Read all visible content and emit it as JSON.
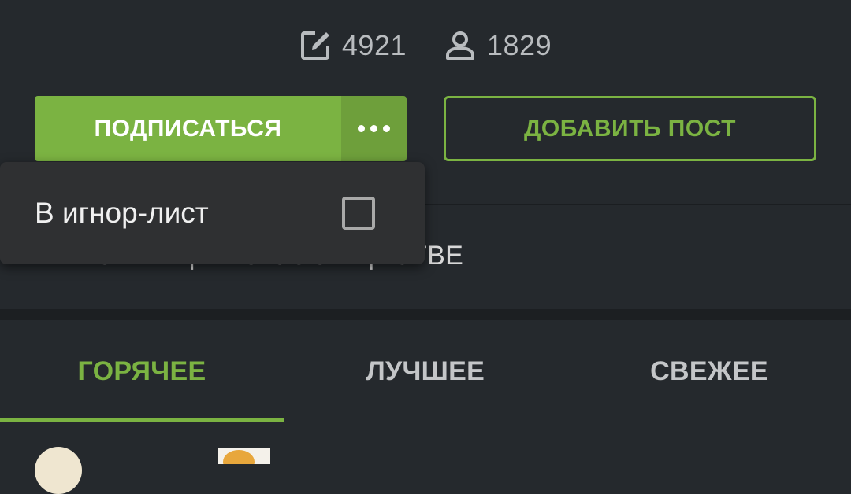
{
  "stats": {
    "posts_count": "4921",
    "posts_icon": "edit-icon",
    "subscribers_count": "1829",
    "subscribers_icon": "user-icon"
  },
  "actions": {
    "subscribe_label": "ПОДПИСАТЬСЯ",
    "more_icon": "more-dots-icon",
    "add_post_label": "ДОБАВИТЬ ПОСТ"
  },
  "community_info_label": "ИНФОРМАЦИЯ О СООБЩЕСТВЕ",
  "tabs": [
    {
      "label": "ГОРЯЧЕЕ",
      "active": true
    },
    {
      "label": "ЛУЧШЕЕ",
      "active": false
    },
    {
      "label": "СВЕЖЕЕ",
      "active": false
    }
  ],
  "popup_menu": {
    "items": [
      {
        "label": "В игнор-лист",
        "checked": false
      }
    ]
  },
  "colors": {
    "accent": "#7bb342",
    "background": "#25292d",
    "popup_background": "#2f3032"
  }
}
